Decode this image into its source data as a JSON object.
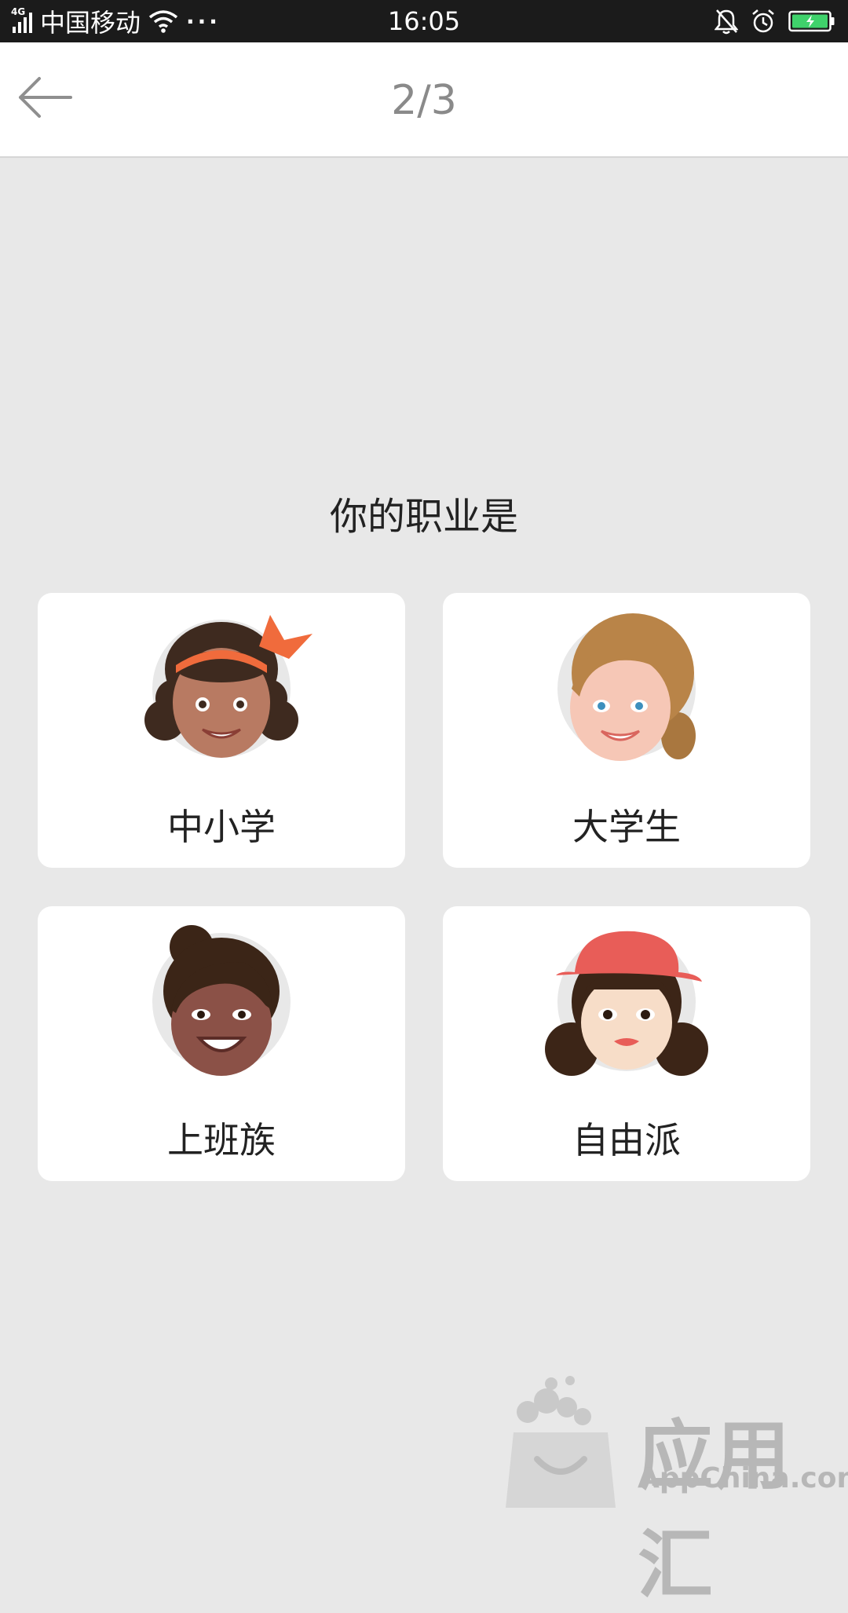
{
  "status_bar": {
    "network": "4G",
    "carrier": "中国移动",
    "more": "···",
    "time": "16:05",
    "icons": [
      "signal-icon",
      "wifi-icon",
      "notification-off-icon",
      "alarm-icon",
      "battery-charging-icon"
    ]
  },
  "header": {
    "step": "2/3",
    "back_icon": "arrow-left-icon"
  },
  "question": "你的职业是",
  "options": [
    {
      "label": "中小学",
      "avatar": "girl-with-headband-avatar"
    },
    {
      "label": "大学生",
      "avatar": "woman-with-ponytail-avatar"
    },
    {
      "label": "上班族",
      "avatar": "woman-with-bun-avatar"
    },
    {
      "label": "自由派",
      "avatar": "woman-with-red-hat-avatar"
    }
  ],
  "watermark": {
    "brand_cn": "应用汇",
    "brand_en": "AppChina.com"
  },
  "colors": {
    "background": "#e8e8e8",
    "card": "#ffffff",
    "header_text": "#8a8a8a",
    "accent_red": "#e85d58",
    "battery": "#3fd26b"
  }
}
